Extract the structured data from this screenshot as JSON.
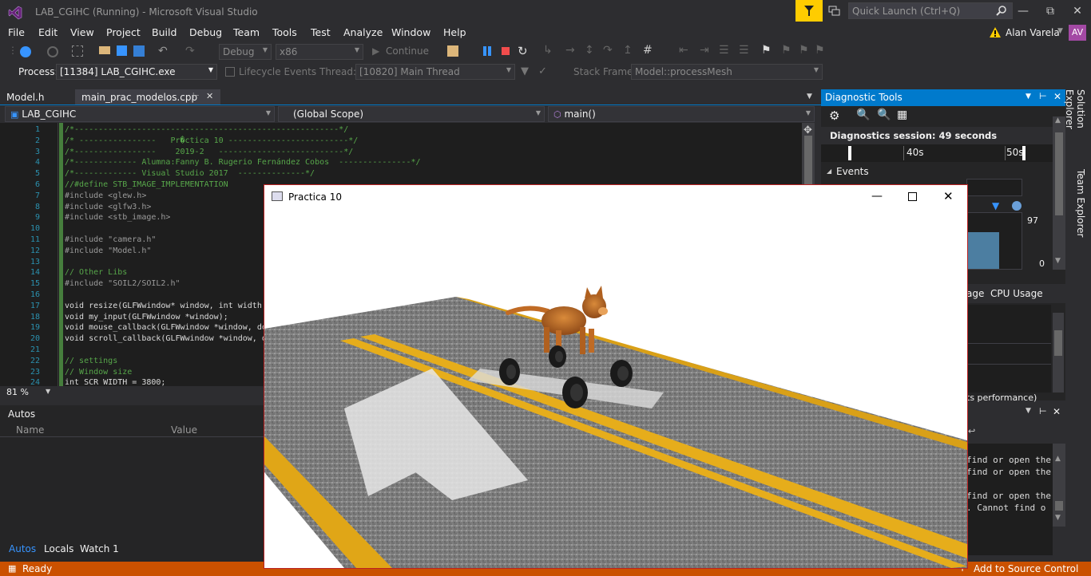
{
  "window": {
    "title": "LAB_CGIHC (Running) - Microsoft Visual Studio"
  },
  "quick_launch": {
    "placeholder": "Quick Launch (Ctrl+Q)"
  },
  "menu": [
    "File",
    "Edit",
    "View",
    "Project",
    "Build",
    "Debug",
    "Team",
    "Tools",
    "Test",
    "Analyze",
    "Window",
    "Help"
  ],
  "user": {
    "name": "Alan Varela",
    "initials": "AV"
  },
  "toolbar": {
    "config": "Debug",
    "platform": "x86",
    "continue_label": "Continue",
    "process_label": "Process:",
    "process_value": "[11384] LAB_CGIHC.exe",
    "lifecycle_label": "Lifecycle Events",
    "thread_label": "Thread:",
    "thread_value": "[10820] Main Thread",
    "stackframe_label": "Stack Frame:",
    "stackframe_value": "Model::processMesh"
  },
  "tabs": [
    {
      "label": "Model.h"
    },
    {
      "label": "main_prac_modelos.cpp"
    }
  ],
  "nav": {
    "project": "LAB_CGIHC",
    "scope": "(Global Scope)",
    "member": "main()"
  },
  "code_lines": [
    {
      "n": "1",
      "text": "/*-------------------------------------------------------*/",
      "cls": "cm"
    },
    {
      "n": "2",
      "text": "/* ----------------   Pr�ctica 10 -------------------------*/",
      "cls": "cm"
    },
    {
      "n": "3",
      "text": "/*-----------------    2019-2   --------------------------*/",
      "cls": "cm"
    },
    {
      "n": "4",
      "text": "/*------------- Alumna:Fanny B. Rugerio Fernández Cobos  ---------------*/",
      "cls": "cm"
    },
    {
      "n": "5",
      "text": "/*------------- Visual Studio 2017  --------------*/",
      "cls": "cm"
    },
    {
      "n": "6",
      "text": "//#define STB_IMAGE_IMPLEMENTATION",
      "cls": "cm"
    },
    {
      "n": "7",
      "text": "#include <glew.h>",
      "cls": "pp"
    },
    {
      "n": "8",
      "text": "#include <glfw3.h>",
      "cls": "pp"
    },
    {
      "n": "9",
      "text": "#include <stb_image.h>",
      "cls": "pp"
    },
    {
      "n": "10",
      "text": "",
      "cls": ""
    },
    {
      "n": "11",
      "text": "#include \"camera.h\"",
      "cls": "pp"
    },
    {
      "n": "12",
      "text": "#include \"Model.h\"",
      "cls": "pp"
    },
    {
      "n": "13",
      "text": "",
      "cls": ""
    },
    {
      "n": "14",
      "text": "// Other Libs",
      "cls": "cm"
    },
    {
      "n": "15",
      "text": "#include \"SOIL2/SOIL2.h\"",
      "cls": "pp"
    },
    {
      "n": "16",
      "text": "",
      "cls": ""
    },
    {
      "n": "17",
      "text": "void resize(GLFWwindow* window, int width,",
      "cls": ""
    },
    {
      "n": "18",
      "text": "void my_input(GLFWwindow *window);",
      "cls": ""
    },
    {
      "n": "19",
      "text": "void mouse_callback(GLFWwindow *window, dou",
      "cls": ""
    },
    {
      "n": "20",
      "text": "void scroll_callback(GLFWwindow *window, do",
      "cls": ""
    },
    {
      "n": "21",
      "text": "",
      "cls": ""
    },
    {
      "n": "22",
      "text": "// settings",
      "cls": "cm"
    },
    {
      "n": "23",
      "text": "// Window size",
      "cls": "cm"
    },
    {
      "n": "24",
      "text": "int SCR_WIDTH = 3800;",
      "cls": ""
    }
  ],
  "editor": {
    "zoom": "81 %"
  },
  "autos": {
    "title": "Autos",
    "col_name": "Name",
    "col_value": "Value"
  },
  "bottom_tabs": [
    "Autos",
    "Locals",
    "Watch 1"
  ],
  "status": {
    "text": "Ready",
    "source_control": "Add to Source Control"
  },
  "diagnostic": {
    "title": "Diagnostic Tools",
    "session": "Diagnostics session: 49 seconds",
    "tick_40": "40s",
    "tick_50": "50s",
    "events": "Events",
    "val_97": "97",
    "val_0": "0",
    "tab_memory_partial": "age",
    "tab_cpu": "CPU Usage",
    "perf_partial": "ts performance)"
  },
  "side_tabs": [
    "Solution Explorer",
    "Team Explorer"
  ],
  "output_lines": [
    "find or open the",
    "find or open the",
    "",
    "find or open the",
    ". Cannot find o"
  ],
  "app_window": {
    "title": "Practica 10"
  },
  "colors": {
    "accent": "#007acc",
    "status": "#ca5100",
    "editor_bg": "#1e1e1e"
  }
}
